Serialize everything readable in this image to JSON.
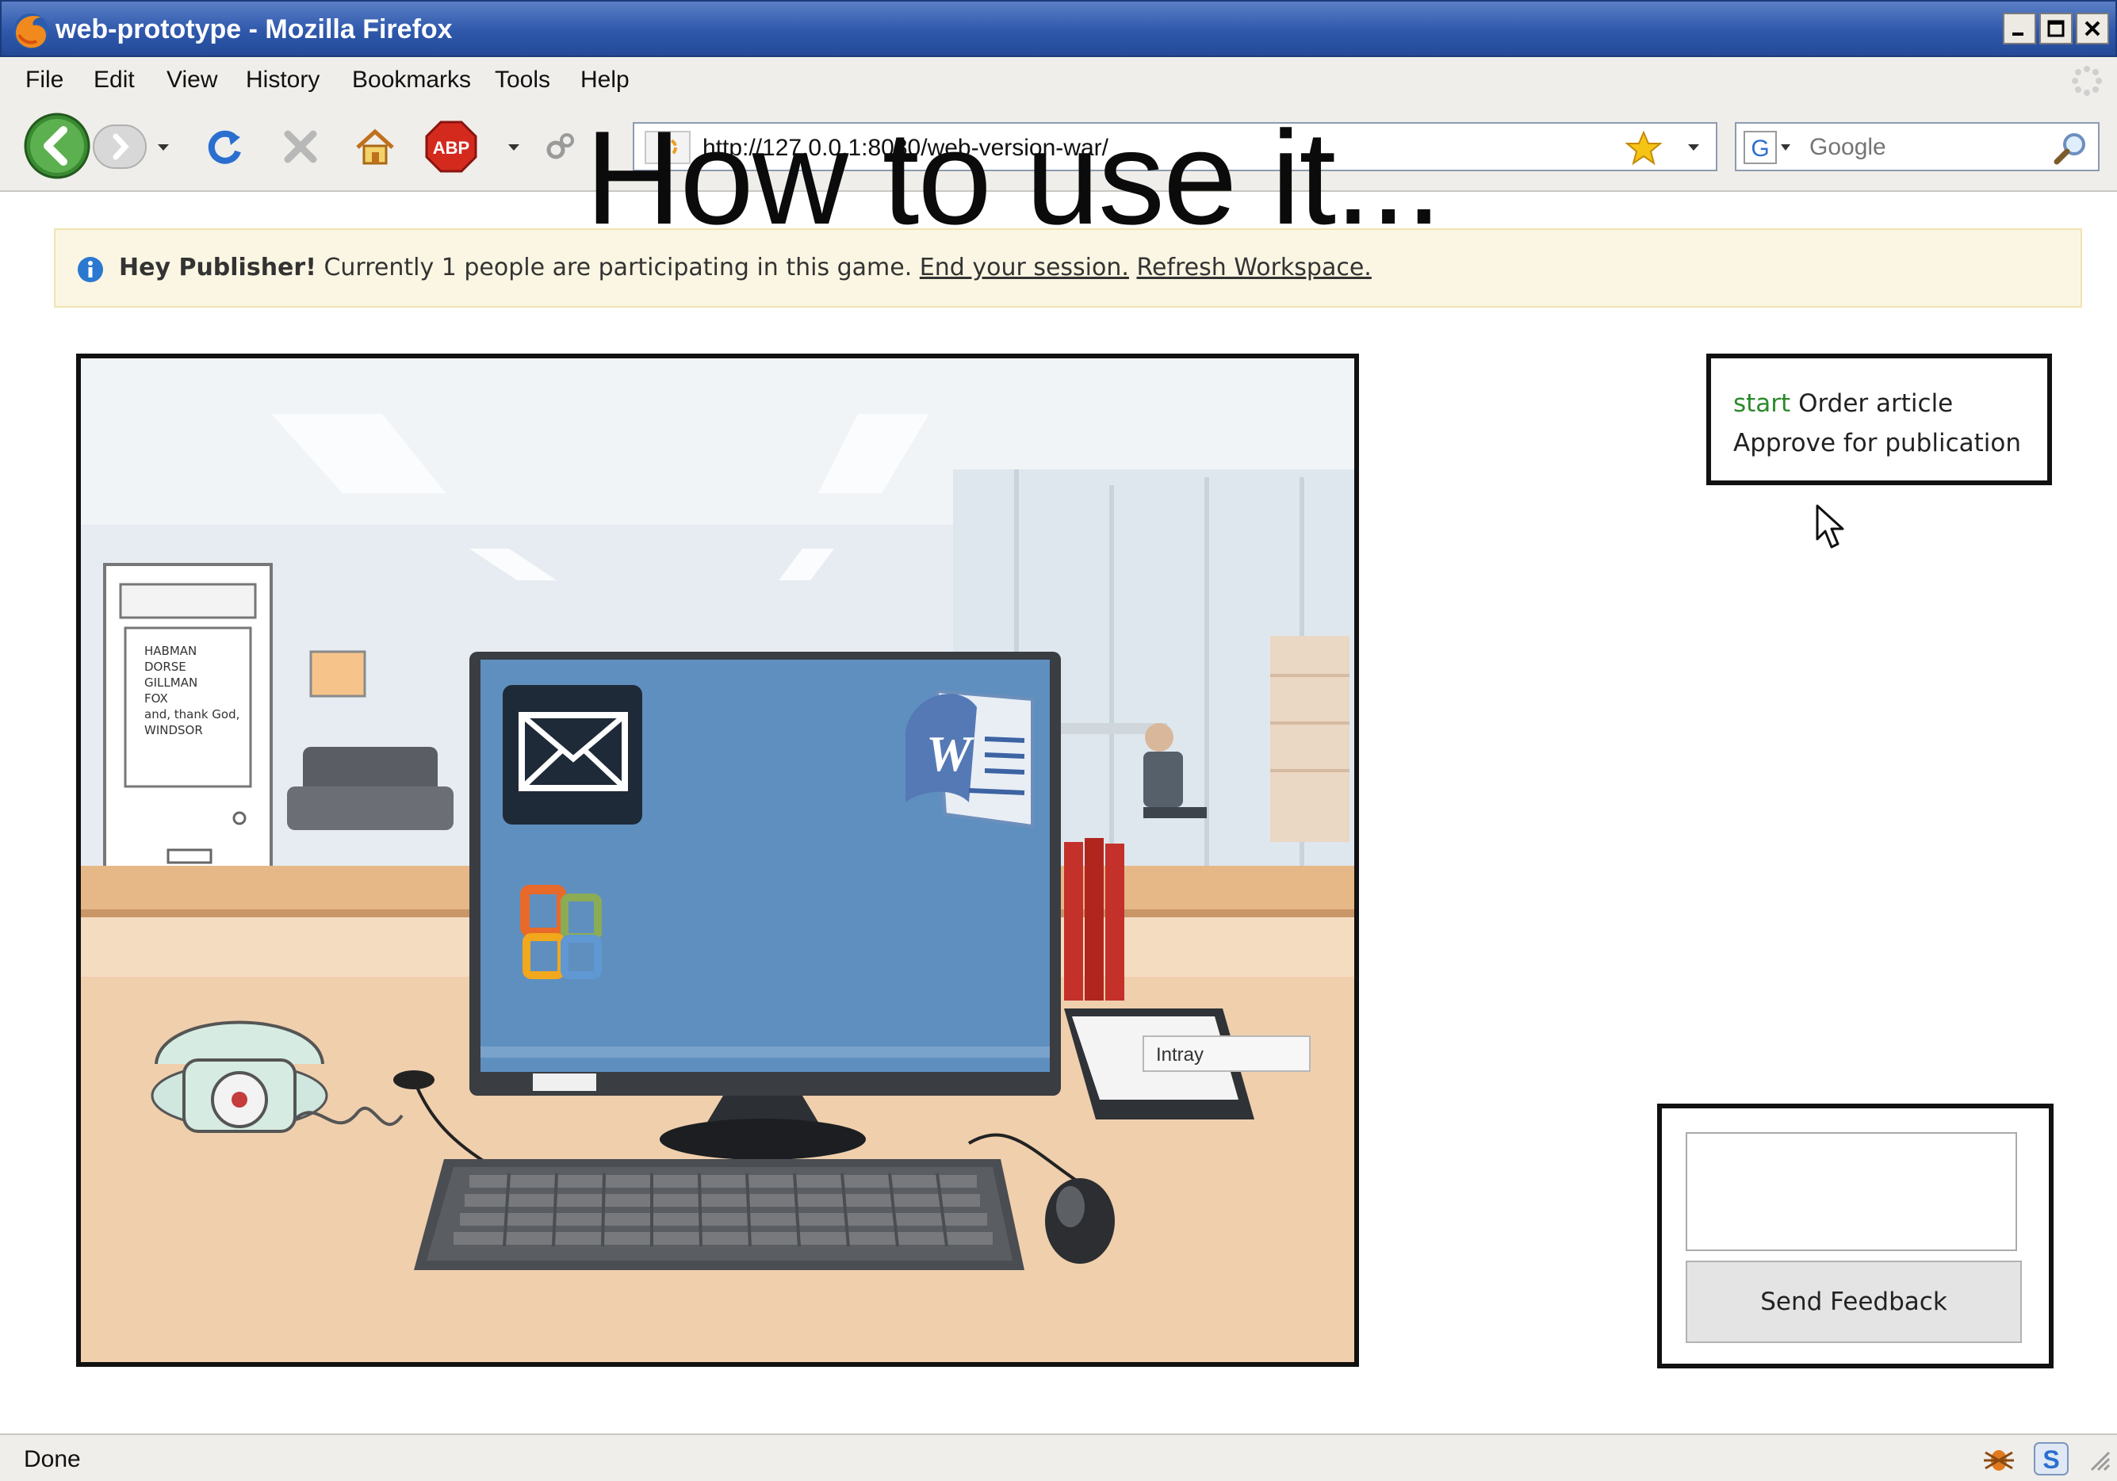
{
  "window": {
    "title": "web-prototype - Mozilla Firefox"
  },
  "menubar": {
    "items": [
      "File",
      "Edit",
      "View",
      "History",
      "Bookmarks",
      "Tools",
      "Help"
    ]
  },
  "toolbar": {
    "url": "http://127.0.0.1:8080/web-version-war/",
    "search_placeholder": "Google",
    "adblock_label": "ABP"
  },
  "overlay": {
    "heading": "How to use it..."
  },
  "notice": {
    "greeting": "Hey Publisher!",
    "message": "Currently 1 people are participating in this game.",
    "end_link": "End your session.",
    "refresh_link": "Refresh Workspace."
  },
  "scene": {
    "door_names": [
      "HABMAN",
      "DORSE",
      "GILLMAN",
      "FOX",
      "and, thank God,",
      "WINDSOR"
    ],
    "intray_label": "Intray",
    "word_letter": "W"
  },
  "tasks": {
    "line1_status": "start",
    "line1_text": "Order article",
    "line2_text": "Approve for publication"
  },
  "feedback": {
    "input_value": "",
    "button_label": "Send Feedback"
  },
  "statusbar": {
    "text": "Done"
  },
  "colors": {
    "titlebar": "#2f58ab",
    "chrome": "#efeeea",
    "notice_bg": "#fbf6e3",
    "start_green": "#2b8a2b",
    "screen_blue": "#5f8fbf"
  }
}
